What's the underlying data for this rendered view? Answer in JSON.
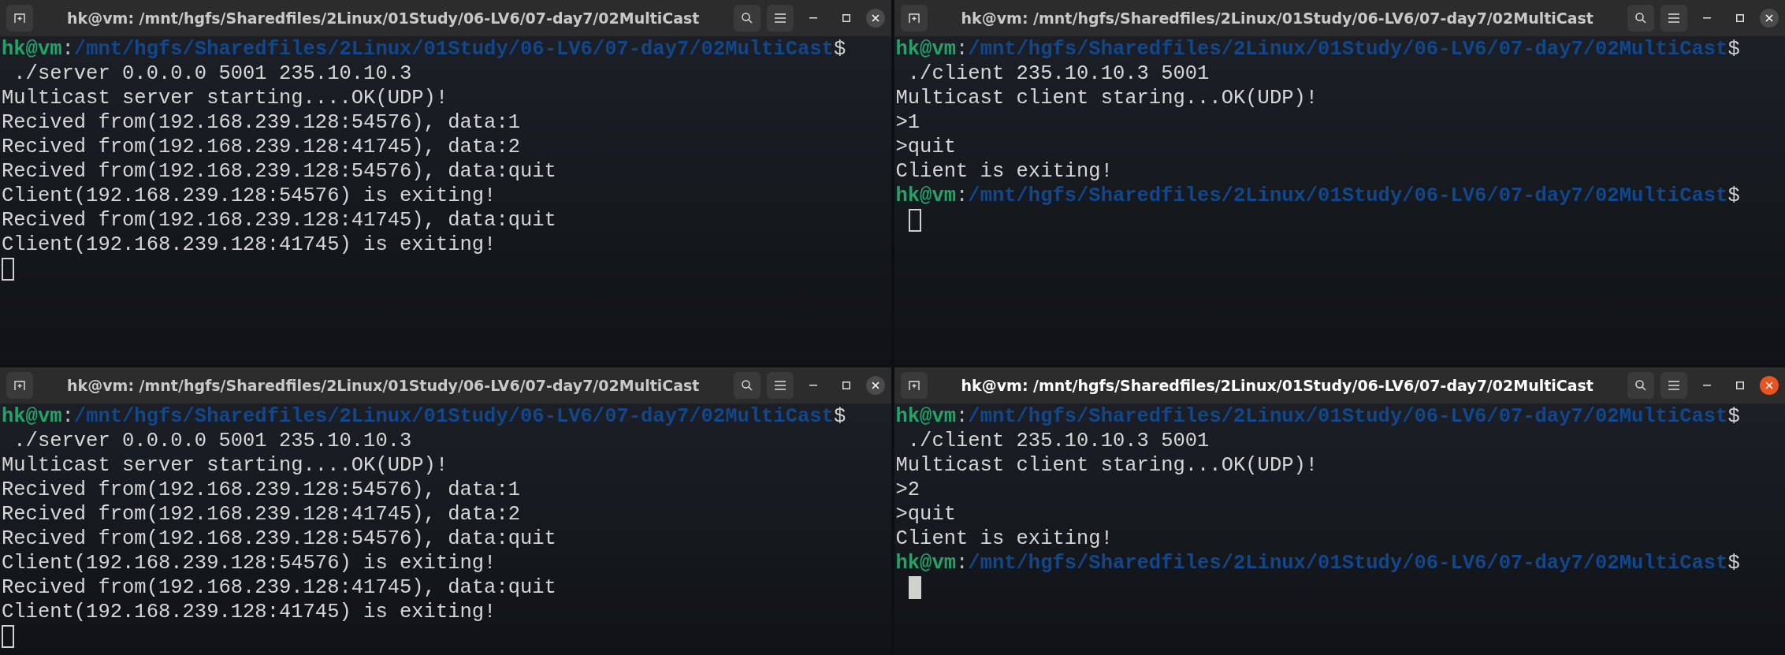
{
  "windows": [
    {
      "title": "hk@vm: /mnt/hgfs/Sharedfiles/2Linux/01Study/06-LV6/07-day7/02MultiCast",
      "focused": false,
      "lines": [
        {
          "kind": "prompt",
          "user": "hk@vm",
          "sep": ":",
          "path": "/mnt/hgfs/Sharedfiles/2Linux/01Study/06-LV6/07-day7/02MultiCast",
          "sign": "$"
        },
        {
          "kind": "output",
          "text": " ./server 0.0.0.0 5001 235.10.10.3"
        },
        {
          "kind": "output",
          "text": "Multicast server starting....OK(UDP)!"
        },
        {
          "kind": "output",
          "text": "Recived from(192.168.239.128:54576), data:1"
        },
        {
          "kind": "output",
          "text": "Recived from(192.168.239.128:41745), data:2"
        },
        {
          "kind": "output",
          "text": "Recived from(192.168.239.128:54576), data:quit"
        },
        {
          "kind": "output",
          "text": "Client(192.168.239.128:54576) is exiting!"
        },
        {
          "kind": "output",
          "text": "Recived from(192.168.239.128:41745), data:quit"
        },
        {
          "kind": "output",
          "text": "Client(192.168.239.128:41745) is exiting!"
        },
        {
          "kind": "cursor"
        }
      ]
    },
    {
      "title": "hk@vm: /mnt/hgfs/Sharedfiles/2Linux/01Study/06-LV6/07-day7/02MultiCast",
      "focused": false,
      "lines": [
        {
          "kind": "prompt",
          "user": "hk@vm",
          "sep": ":",
          "path": "/mnt/hgfs/Sharedfiles/2Linux/01Study/06-LV6/07-day7/02MultiCast",
          "sign": "$"
        },
        {
          "kind": "output",
          "text": " ./client 235.10.10.3 5001"
        },
        {
          "kind": "output",
          "text": "Multicast client staring...OK(UDP)!"
        },
        {
          "kind": "output",
          "text": ">1"
        },
        {
          "kind": "output",
          "text": ">quit"
        },
        {
          "kind": "output",
          "text": "Client is exiting!"
        },
        {
          "kind": "prompt",
          "user": "hk@vm",
          "sep": ":",
          "path": "/mnt/hgfs/Sharedfiles/2Linux/01Study/06-LV6/07-day7/02MultiCast",
          "sign": "$"
        },
        {
          "kind": "wrapped_cursor"
        }
      ]
    },
    {
      "title": "hk@vm: /mnt/hgfs/Sharedfiles/2Linux/01Study/06-LV6/07-day7/02MultiCast",
      "focused": false,
      "lines": [
        {
          "kind": "prompt",
          "user": "hk@vm",
          "sep": ":",
          "path": "/mnt/hgfs/Sharedfiles/2Linux/01Study/06-LV6/07-day7/02MultiCast",
          "sign": "$"
        },
        {
          "kind": "output",
          "text": " ./server 0.0.0.0 5001 235.10.10.3"
        },
        {
          "kind": "output",
          "text": "Multicast server starting....OK(UDP)!"
        },
        {
          "kind": "output",
          "text": "Recived from(192.168.239.128:54576), data:1"
        },
        {
          "kind": "output",
          "text": "Recived from(192.168.239.128:41745), data:2"
        },
        {
          "kind": "output",
          "text": "Recived from(192.168.239.128:54576), data:quit"
        },
        {
          "kind": "output",
          "text": "Client(192.168.239.128:54576) is exiting!"
        },
        {
          "kind": "output",
          "text": "Recived from(192.168.239.128:41745), data:quit"
        },
        {
          "kind": "output",
          "text": "Client(192.168.239.128:41745) is exiting!"
        },
        {
          "kind": "cursor"
        }
      ]
    },
    {
      "title": "hk@vm: /mnt/hgfs/Sharedfiles/2Linux/01Study/06-LV6/07-day7/02MultiCast",
      "focused": true,
      "lines": [
        {
          "kind": "prompt",
          "user": "hk@vm",
          "sep": ":",
          "path": "/mnt/hgfs/Sharedfiles/2Linux/01Study/06-LV6/07-day7/02MultiCast",
          "sign": "$"
        },
        {
          "kind": "output",
          "text": " ./client 235.10.10.3 5001"
        },
        {
          "kind": "output",
          "text": "Multicast client staring...OK(UDP)!"
        },
        {
          "kind": "output",
          "text": ">2"
        },
        {
          "kind": "output",
          "text": ">quit"
        },
        {
          "kind": "output",
          "text": "Client is exiting!"
        },
        {
          "kind": "prompt",
          "user": "hk@vm",
          "sep": ":",
          "path": "/mnt/hgfs/Sharedfiles/2Linux/01Study/06-LV6/07-day7/02MultiCast",
          "sign": "$"
        },
        {
          "kind": "wrapped_cursor"
        }
      ]
    }
  ]
}
